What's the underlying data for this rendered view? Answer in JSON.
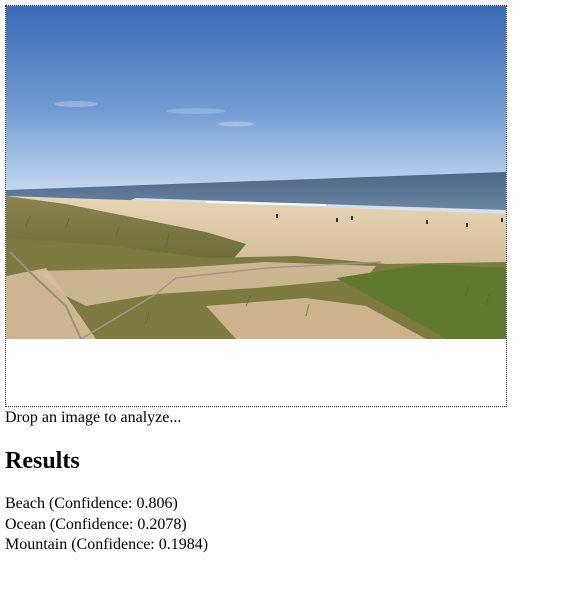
{
  "drop_zone": {
    "image_subject": "beach with sand dunes, fence, ocean and blue sky",
    "hint": "Drop an image to analyze..."
  },
  "results": {
    "heading": "Results",
    "items": [
      {
        "label": "Beach",
        "confidence": 0.806,
        "text": "Beach (Confidence: 0.806)"
      },
      {
        "label": "Ocean",
        "confidence": 0.2078,
        "text": "Ocean (Confidence: 0.2078)"
      },
      {
        "label": "Mountain",
        "confidence": 0.1984,
        "text": "Mountain (Confidence: 0.1984)"
      }
    ]
  },
  "colors": {
    "sky_top": "#3d6fb8",
    "sky_horizon": "#bcd3ec",
    "ocean": "#55708f",
    "surf": "#e8eef3",
    "sand": "#dcc9a6",
    "dune_grass": "#6f7d3a",
    "border": "#333333"
  }
}
